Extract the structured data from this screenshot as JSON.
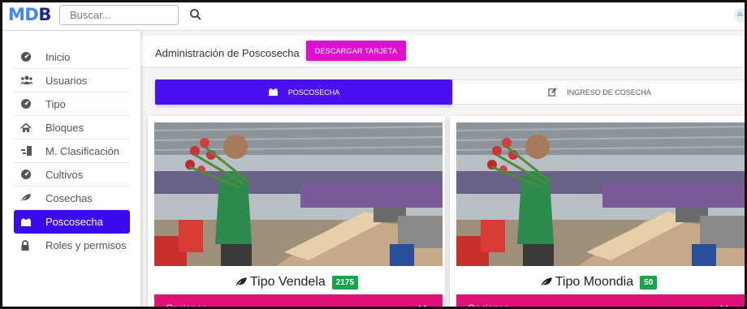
{
  "topbar": {
    "logo": {
      "part1": "MD",
      "part2": "B"
    },
    "search": {
      "placeholder": "Buscar...",
      "value": ""
    },
    "user_badge": "AL"
  },
  "sidebar": {
    "items": [
      {
        "label": "Inicio",
        "icon": "tachometer-icon"
      },
      {
        "label": "Usuarios",
        "icon": "users-icon"
      },
      {
        "label": "Tipo",
        "icon": "tachometer-icon"
      },
      {
        "label": "Bloques",
        "icon": "home-icon"
      },
      {
        "label": "M. Clasificación",
        "icon": "classification-icon"
      },
      {
        "label": "Cultivos",
        "icon": "tachometer-icon"
      },
      {
        "label": "Cosechas",
        "icon": "leaf-icon"
      },
      {
        "label": "Poscosecha",
        "icon": "box-icon",
        "active": true
      },
      {
        "label": "Roles y permisos",
        "icon": "lock-icon"
      }
    ]
  },
  "header": {
    "title": "Administración de Poscosecha",
    "download_label": "DESCARGAR TARJETA"
  },
  "tabs": [
    {
      "label": "POSCOSECHA",
      "icon": "box-icon",
      "active": true
    },
    {
      "label": "INGRESO DE COSECHA",
      "icon": "edit-icon",
      "active": false
    }
  ],
  "cards": [
    {
      "title": "Tipo Vendela",
      "count": "2175",
      "options_label": "Opciones"
    },
    {
      "title": "Tipo Moondia",
      "count": "50",
      "options_label": "Opciones"
    }
  ],
  "colors": {
    "primary": "#3d0aef",
    "accent": "#e10fcd",
    "options": "#e0117a",
    "badge": "#1aa34a",
    "logo_blue": "#4285f4"
  }
}
